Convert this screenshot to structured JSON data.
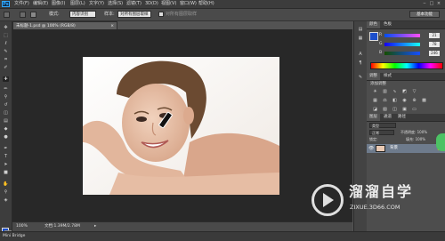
{
  "app": {
    "logo": "Ps"
  },
  "menubar": {
    "items": [
      "文件(F)",
      "编辑(E)",
      "图像(I)",
      "图层(L)",
      "文字(Y)",
      "选择(S)",
      "滤镜(T)",
      "3D(D)",
      "视图(V)",
      "窗口(W)",
      "帮助(H)"
    ],
    "window_buttons": [
      "‒",
      "□",
      "×"
    ]
  },
  "options": {
    "mode_label": "模式:",
    "mode_value": "内容识别",
    "source_label": "样本:",
    "source_value": "对所有图层取样",
    "checkbox_label": "对所有图层取样",
    "workspace": "基本功能"
  },
  "document": {
    "tab_title": "未标题-1.psd @ 100% (RGB/8)",
    "close": "×",
    "zoom": "100%",
    "doc_info": "文档:1.39M/2.78M",
    "status_arrow": "▸"
  },
  "footer": {
    "mini_bridge": "Mini Bridge"
  },
  "panels": {
    "color_tabs": [
      "颜色",
      "色板"
    ],
    "sliders": [
      {
        "label": "R",
        "value": "21"
      },
      {
        "label": "G",
        "value": "78"
      },
      {
        "label": "B",
        "value": "246"
      }
    ],
    "adjust_tabs": [
      "调整",
      "样式"
    ],
    "adjust_title": "添加调整",
    "layer_tabs": [
      "图层",
      "通道",
      "路径"
    ],
    "layer_kind": "类型",
    "blend_mode": "正常",
    "opacity_label": "不透明度: 100%",
    "lock_label": "锁定:",
    "fill_label": "填充: 100%",
    "layer_name": "背景",
    "lock_icon": "🔒",
    "eye_icon": "👁"
  },
  "watermark": {
    "title": "溜溜自学",
    "url": "ZIXUE.3D66.COM"
  },
  "colors": {
    "accent": "#31a8ff",
    "fg": "#1d4fcc",
    "bg": "#ffffff",
    "layer_selected": "#6e7b8c"
  }
}
